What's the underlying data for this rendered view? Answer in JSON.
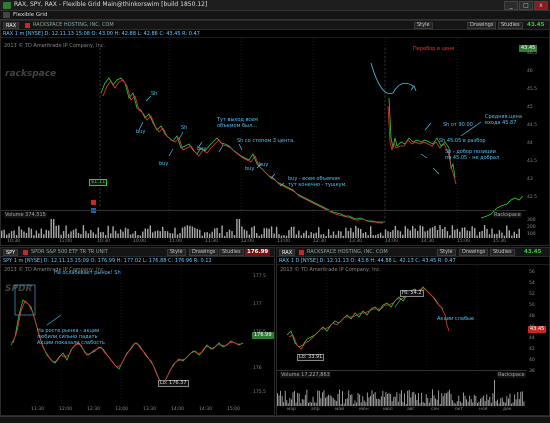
{
  "window": {
    "title": "RAX, SPY, RAX - Flexible Grid Main@thinkorswim [build 1850.12]",
    "tab": "Flexible Grid",
    "controls": [
      "_",
      "□",
      "x"
    ]
  },
  "top_chart": {
    "symbol": "RAX",
    "company": "RACKSPACE HOSTING, INC. COM",
    "last": "43.45",
    "last_color": "#33cc33",
    "buttons": [
      "Style",
      "Drawings",
      "Studies"
    ],
    "quote_line": "RAX 1 m [NYSE]  D: 12.11.13 15:08  O: 43.00  H: 42.88  L: 42.86  C: 43.45  R: 0.47",
    "chart_label": "2013 © TD Ameritrade IP Company, Inc.",
    "price_axis": [
      "46.5",
      "46",
      "45.5",
      "45",
      "44.5",
      "44",
      "43.5",
      "43",
      "42.5"
    ],
    "time_axis": [
      "10:30",
      "12:00",
      "10:30",
      "10:00",
      "11:00",
      "11:30",
      "12:00",
      "13:00",
      "12:30",
      "13:30",
      "14:00",
      "14:30",
      "15:00",
      "15:30"
    ],
    "volume_label": "Volume  374,515",
    "volume_right_label": "Rackspace",
    "volume_axis": [
      "300",
      "200",
      "100"
    ],
    "price_labels": {
      "low": "$1.11",
      "current": "43.45"
    },
    "annotations": {
      "buy1": "buy",
      "buy2": "buy",
      "buy3": "buy",
      "buy4": "buy",
      "buy5": "buy",
      "sh1": "Sh",
      "sh2": "Sh",
      "sh3": "Sh",
      "tut_vyhod": "Тут выход всем\nобъемом был...",
      "sh_stopom": "Sh  со стопом 3 цента.",
      "buy_vsem": "buy - всем объемом\nтут конечно - тушкум.",
      "perebor_vverh": "Перебор в цене",
      "sh_90": "Sh от 90.00",
      "srednyaya": "Средняя цена\nвхода 45.87",
      "sh_4505": "Sh 45.05 в разбор",
      "sh_dobor": "Sh - добор позиции\nпо 45.05 - не добрал"
    }
  },
  "left_chart": {
    "symbol": "SPY",
    "company": "SPDR S&P 500 ETF TR TR UNIT",
    "last": "176.99",
    "last_color": "#ff4444",
    "buttons": [
      "Style",
      "Drawings",
      "Studies"
    ],
    "quote_line": "SPY 1 m [NYSE]  D: 12.11.13 15:09  O: 176.99  H: 177.02  L: 176.88  C: 176.96  R: 0.12",
    "chart_label": "2013 © TD Ameritrade IP Company, Inc.",
    "price_axis": [
      "177.5",
      "177",
      "176.5",
      "176",
      "175.5"
    ],
    "time_axis": [
      "11:30",
      "12:00",
      "12:30",
      "13:00",
      "13:30",
      "14:00",
      "14:30",
      "15:00"
    ],
    "annotations": {
      "oslabil": "На ослабевает рынок! Sh",
      "na_roste": "На росте рынка - акции\nлюбили сильно падать\nАкции показали слабость"
    },
    "low_label": "Lo: 176.37",
    "current_label": "176.99"
  },
  "right_chart": {
    "symbol": "RAX",
    "company": "RACKSPACE HOSTING, INC. COM",
    "last": "43.45",
    "last_color": "#33cc33",
    "buttons": [
      "Style",
      "Drawings",
      "Studies"
    ],
    "quote_line": "RAX 1 D [NYSE]  D: 12.11.13  O: 43.8  H: 44.88  L: 42.13  C: 43.45  R: 0.47",
    "chart_label": "2013 © TD Ameritrade IP Company, Inc.",
    "price_axis": [
      "56",
      "54",
      "52",
      "50",
      "48",
      "46",
      "44",
      "42",
      "40",
      "38"
    ],
    "time_axis": [
      "мар",
      "апр",
      "май",
      "июн",
      "июл",
      "авг",
      "сен",
      "окт",
      "ноя",
      "дек"
    ],
    "annotations": {
      "hi": "Hi: 54.2",
      "lo": "Lo: 33.91",
      "akcii_slabye": "Акции слабые"
    },
    "current_label": "43.45",
    "volume_label": "Volume  17,227,863",
    "volume_right_label": "Rackspace"
  },
  "status": {
    "text": ""
  }
}
